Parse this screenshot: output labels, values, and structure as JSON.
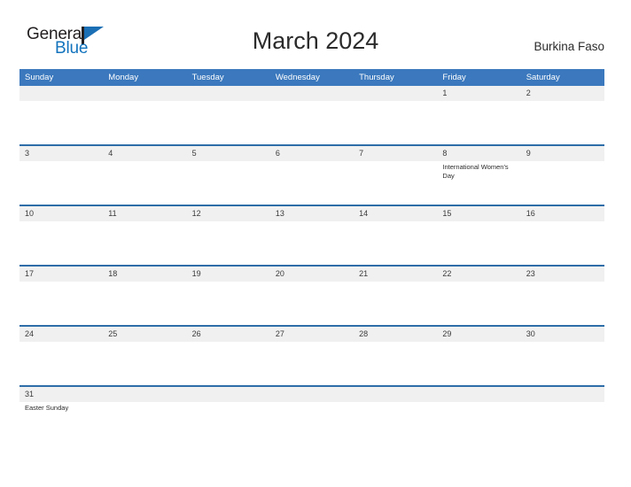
{
  "brand": {
    "word_one": "General",
    "word_two": "Blue",
    "flag_icon": "flag-triangle-icon",
    "colors": {
      "dark": "#231f20",
      "blue": "#1273bd"
    }
  },
  "header": {
    "title": "March 2024",
    "country": "Burkina Faso"
  },
  "theme": {
    "header_bar": "#3b78bd",
    "row_divider": "#2e6da8",
    "date_band": "#f0f0f0",
    "text": "#2b2b2b"
  },
  "calendar": {
    "day_headers": [
      "Sunday",
      "Monday",
      "Tuesday",
      "Wednesday",
      "Thursday",
      "Friday",
      "Saturday"
    ],
    "weeks": [
      {
        "days": [
          {
            "num": "",
            "event": ""
          },
          {
            "num": "",
            "event": ""
          },
          {
            "num": "",
            "event": ""
          },
          {
            "num": "",
            "event": ""
          },
          {
            "num": "",
            "event": ""
          },
          {
            "num": "1",
            "event": ""
          },
          {
            "num": "2",
            "event": ""
          }
        ]
      },
      {
        "days": [
          {
            "num": "3",
            "event": ""
          },
          {
            "num": "4",
            "event": ""
          },
          {
            "num": "5",
            "event": ""
          },
          {
            "num": "6",
            "event": ""
          },
          {
            "num": "7",
            "event": ""
          },
          {
            "num": "8",
            "event": "International Women's Day"
          },
          {
            "num": "9",
            "event": ""
          }
        ]
      },
      {
        "days": [
          {
            "num": "10",
            "event": ""
          },
          {
            "num": "11",
            "event": ""
          },
          {
            "num": "12",
            "event": ""
          },
          {
            "num": "13",
            "event": ""
          },
          {
            "num": "14",
            "event": ""
          },
          {
            "num": "15",
            "event": ""
          },
          {
            "num": "16",
            "event": ""
          }
        ]
      },
      {
        "days": [
          {
            "num": "17",
            "event": ""
          },
          {
            "num": "18",
            "event": ""
          },
          {
            "num": "19",
            "event": ""
          },
          {
            "num": "20",
            "event": ""
          },
          {
            "num": "21",
            "event": ""
          },
          {
            "num": "22",
            "event": ""
          },
          {
            "num": "23",
            "event": ""
          }
        ]
      },
      {
        "days": [
          {
            "num": "24",
            "event": ""
          },
          {
            "num": "25",
            "event": ""
          },
          {
            "num": "26",
            "event": ""
          },
          {
            "num": "27",
            "event": ""
          },
          {
            "num": "28",
            "event": ""
          },
          {
            "num": "29",
            "event": ""
          },
          {
            "num": "30",
            "event": ""
          }
        ]
      },
      {
        "days": [
          {
            "num": "31",
            "event": "Easter Sunday"
          },
          {
            "num": "",
            "event": ""
          },
          {
            "num": "",
            "event": ""
          },
          {
            "num": "",
            "event": ""
          },
          {
            "num": "",
            "event": ""
          },
          {
            "num": "",
            "event": ""
          },
          {
            "num": "",
            "event": ""
          }
        ]
      }
    ]
  }
}
